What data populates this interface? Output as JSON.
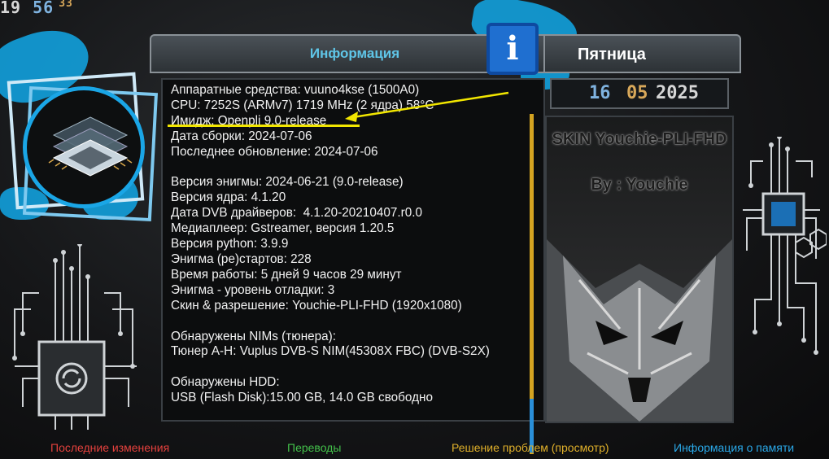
{
  "clock": {
    "hours": "19",
    "minutes": "56",
    "seconds": "33"
  },
  "panel": {
    "title": "Информация",
    "lines": [
      "Аппаратные средства: vuuno4kse (1500A0)",
      "CPU: 7252S (ARMv7) 1719 MHz (2 ядра) 58°C",
      "Имидж: Openpli 9.0-release",
      "Дата сборки: 2024-07-06",
      "Последнее обновление: 2024-07-06",
      "",
      "Версия энигмы: 2024-06-21 (9.0-release)",
      "Версия ядра: 4.1.20",
      "Дата DVB драйверов:  4.1.20-20210407.r0.0",
      "Медиаплеер: Gstreamer, версия 1.20.5",
      "Версия python: 3.9.9",
      "Энигма (ре)стартов: 228",
      "Время работы: 5 дней 9 часов 29 минут",
      "Энигма - уровень отладки: 3",
      "Скин & разрешение: Youchie-PLI-FHD (1920x1080)",
      "",
      "Обнаружены NIMs (тюнера):",
      "Тюнер A-H: Vuplus DVB-S NIM(45308X FBC) (DVB-S2X)",
      "",
      "Обнаружены HDD:",
      "USB (Flash Disk):15.00 GB, 14.0 GB свободно"
    ]
  },
  "info_icon": "i",
  "weekday": "Пятница",
  "date": {
    "day": "16",
    "month": "05",
    "year": "2025"
  },
  "skin": {
    "title": "SKIN Youchie-PLI-FHD",
    "author": "By : Youchie"
  },
  "footer": {
    "red": "Последние изменения",
    "green": "Переводы",
    "yellow": "Решение проблем (просмотр)",
    "blue": "Информация о памяти"
  },
  "colors": {
    "red": "#e4413d",
    "green": "#43c04a",
    "yellow": "#e0b02a",
    "blue": "#2aa8e8",
    "accent": "#12a8e8"
  }
}
